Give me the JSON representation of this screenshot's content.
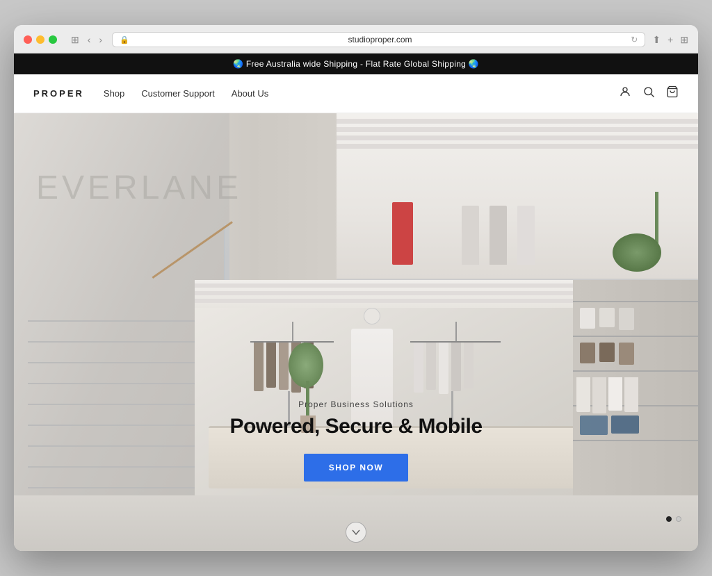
{
  "browser": {
    "url": "studioproper.com",
    "back_label": "‹",
    "forward_label": "›",
    "sidebar_label": "⊞"
  },
  "announcement": {
    "text": "🌏 Free Australia wide Shipping - Flat Rate Global Shipping 🌏"
  },
  "navbar": {
    "logo": "PROPER",
    "links": [
      {
        "label": "Shop"
      },
      {
        "label": "Customer Support"
      },
      {
        "label": "About Us"
      }
    ],
    "icons": {
      "account": "👤",
      "search": "🔍",
      "cart": "🛍"
    }
  },
  "hero": {
    "store_brand": "EVERLANE",
    "subtitle": "Proper Business Solutions",
    "title": "Powered, Secure & Mobile",
    "cta_label": "SHOP NOW",
    "dots": [
      {
        "active": true
      },
      {
        "active": false
      }
    ],
    "scroll_icon": "∨"
  }
}
